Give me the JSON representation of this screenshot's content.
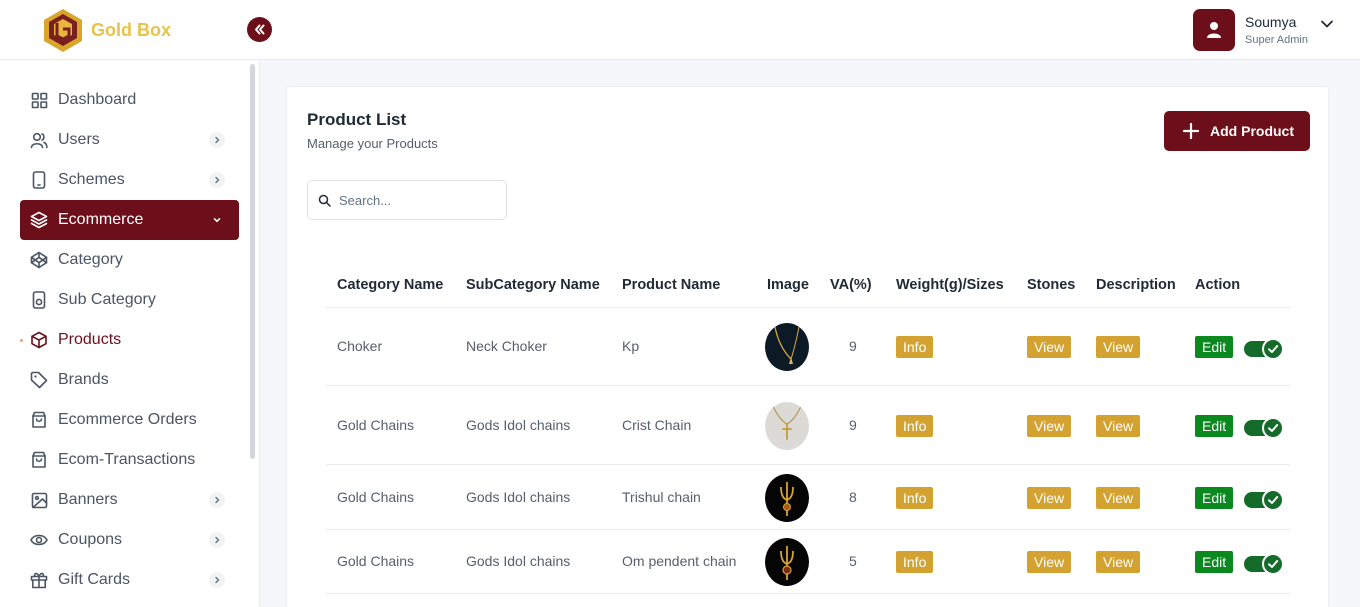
{
  "brand": {
    "name": "Gold Box"
  },
  "user": {
    "name": "Soumya",
    "role": "Super Admin"
  },
  "sidebar": {
    "items": [
      {
        "label": "Dashboard",
        "icon": "dashboard-icon",
        "has_chevron": false
      },
      {
        "label": "Users",
        "icon": "users-icon",
        "has_chevron": true
      },
      {
        "label": "Schemes",
        "icon": "schemes-icon",
        "has_chevron": true
      },
      {
        "label": "Ecommerce",
        "icon": "layers-icon",
        "has_chevron": true,
        "state": "expanded"
      },
      {
        "label": "Category",
        "icon": "codepen-icon",
        "has_chevron": false
      },
      {
        "label": "Sub Category",
        "icon": "subcategory-icon",
        "has_chevron": false
      },
      {
        "label": "Products",
        "icon": "box-icon",
        "has_chevron": false,
        "state": "current"
      },
      {
        "label": "Brands",
        "icon": "tag-icon",
        "has_chevron": false
      },
      {
        "label": "Ecommerce Orders",
        "icon": "shopping-bag-icon",
        "has_chevron": false
      },
      {
        "label": "Ecom-Transactions",
        "icon": "shopping-bag-icon",
        "has_chevron": false
      },
      {
        "label": "Banners",
        "icon": "image-icon",
        "has_chevron": true
      },
      {
        "label": "Coupons",
        "icon": "eye-icon",
        "has_chevron": true
      },
      {
        "label": "Gift Cards",
        "icon": "gift-icon",
        "has_chevron": true
      }
    ]
  },
  "page": {
    "title": "Product List",
    "subtitle": "Manage your Products",
    "add_label": "Add Product",
    "search_placeholder": "Search..."
  },
  "table": {
    "headers": [
      "Category Name",
      "SubCategory Name",
      "Product Name",
      "Image",
      "VA(%)",
      "Weight(g)/Sizes",
      "Stones",
      "Description",
      "Action"
    ],
    "rows": [
      {
        "category": "Choker",
        "subcategory": "Neck Choker",
        "product": "Kp",
        "image": "necklace-dark",
        "va": "9",
        "weight": "Info",
        "stones": "View",
        "description": "View",
        "action": "Edit",
        "active": true
      },
      {
        "category": "Gold Chains",
        "subcategory": "Gods Idol chains",
        "product": "Crist Chain",
        "image": "cross-pendant-light",
        "va": "9",
        "weight": "Info",
        "stones": "View",
        "description": "View",
        "action": "Edit",
        "active": true
      },
      {
        "category": "Gold Chains",
        "subcategory": "Gods Idol chains",
        "product": "Trishul chain",
        "image": "trishul-pendant-dark",
        "va": "8",
        "weight": "Info",
        "stones": "View",
        "description": "View",
        "action": "Edit",
        "active": true
      },
      {
        "category": "Gold Chains",
        "subcategory": "Gods Idol chains",
        "product": "Om pendent chain",
        "image": "om-pendant-dark",
        "va": "5",
        "weight": "Info",
        "stones": "View",
        "description": "View",
        "action": "Edit",
        "active": true
      }
    ]
  },
  "colors": {
    "brand": "#6d0f1a",
    "gold_tag": "#d4a230",
    "green_tag": "#0a8a1e",
    "logo_gold": "#e8c24a"
  }
}
